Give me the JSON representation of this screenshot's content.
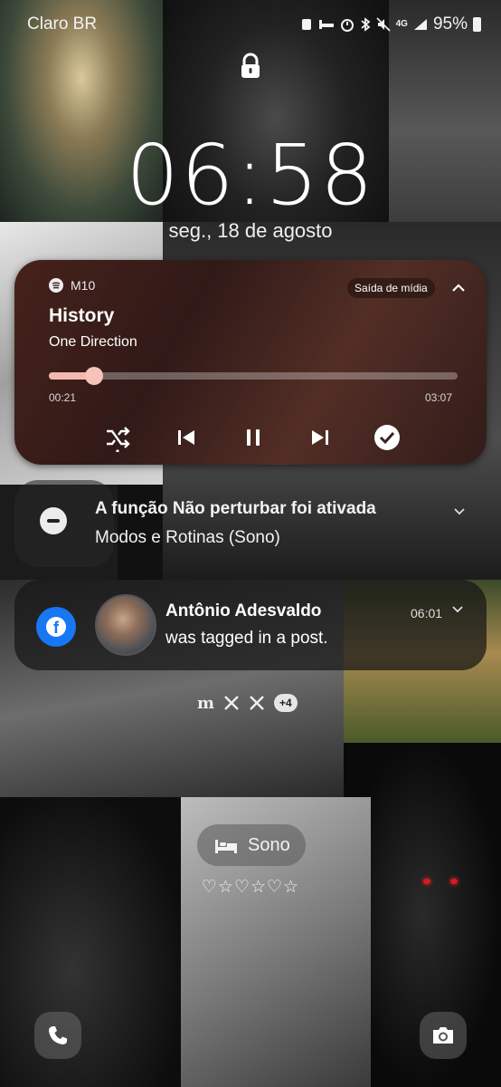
{
  "status_bar": {
    "carrier": "Claro BR",
    "network": "4G",
    "battery": "95%"
  },
  "lock_screen": {
    "time": "06:58",
    "date": "seg., 18 de agosto"
  },
  "media_player": {
    "app_name": "M10",
    "title": "History",
    "artist": "One Direction",
    "output_label": "Saída de mídia",
    "elapsed": "00:21",
    "duration": "03:07",
    "progress_fraction": 0.11,
    "accent": "#f3b9b0"
  },
  "dnd_notification": {
    "title": "A função Não perturbar foi ativada",
    "subtitle": "Modos e Rotinas (Sono)"
  },
  "facebook_notification": {
    "icon": "facebook-icon",
    "sender": "Antônio Adesvaldo",
    "message": "was tagged in a post.",
    "time": "06:01",
    "brand_color": "#1877f2"
  },
  "notification_icons": {
    "icons": [
      "m-icon",
      "x-icon",
      "x-icon"
    ],
    "more": "+4"
  },
  "routine": {
    "label": "Sono",
    "icon": "bed-icon",
    "symbols": "♡☆♡☆♡☆"
  },
  "shortcuts": {
    "left": "phone-icon",
    "right": "camera-icon"
  }
}
